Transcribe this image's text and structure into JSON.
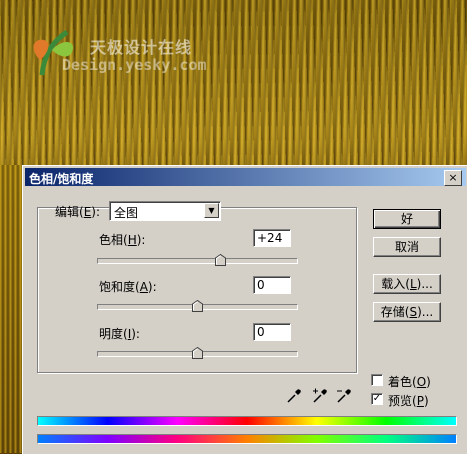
{
  "background": {
    "watermark_line1": "天极设计在线",
    "watermark_line2": "Design.yesky.com"
  },
  "dialog": {
    "title": "色相/饱和度",
    "close_glyph": "×",
    "edit": {
      "label": "编辑",
      "accel": "E",
      "selected": "全图"
    },
    "hue": {
      "label": "色相",
      "accel": "H",
      "value": "+24",
      "slider_fraction": 0.62
    },
    "saturation": {
      "label": "饱和度",
      "accel": "A",
      "value": "0",
      "slider_fraction": 0.5
    },
    "lightness": {
      "label": "明度",
      "accel": "I",
      "value": "0",
      "slider_fraction": 0.5
    },
    "buttons": {
      "ok": "好",
      "cancel": "取消",
      "load": "载入",
      "load_accel": "L",
      "save": "存储",
      "save_accel": "S",
      "ellipsis": "..."
    },
    "colorize": {
      "label": "着色",
      "accel": "O",
      "checked": false
    },
    "preview": {
      "label": "预览",
      "accel": "P",
      "checked": true
    },
    "eyedroppers": [
      "eyedropper-icon",
      "eyedropper-plus-icon",
      "eyedropper-minus-icon"
    ],
    "colors": {
      "title_start": "#0a246a",
      "title_end": "#a6caf0",
      "dialog_bg": "#d4d0c8"
    }
  }
}
